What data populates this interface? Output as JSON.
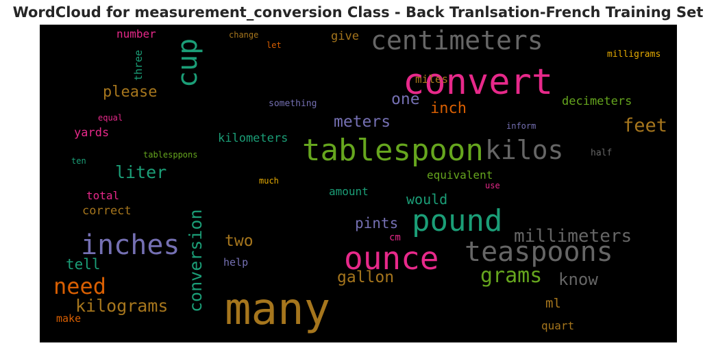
{
  "title": "WordCloud for measurement_conversion Class - Back Tranlsation-French Training Set",
  "words": {
    "many": "many",
    "convert": "convert",
    "tablespoon": "tablespoon",
    "ounce": "ounce",
    "pound": "pound",
    "inches": "inches",
    "teaspoons": "teaspoons",
    "centimeters": "centimeters",
    "kilos": "kilos",
    "cup": "cup",
    "conversion": "conversion",
    "need": "need",
    "grams": "grams",
    "millimeters": "millimeters",
    "kilograms": "kilograms",
    "liter": "liter",
    "feet": "feet",
    "meters": "meters",
    "gallon": "gallon",
    "know": "know",
    "two": "two",
    "one": "one",
    "inch": "inch",
    "please": "please",
    "pints": "pints",
    "tell": "tell",
    "would": "would",
    "decimeters": "decimeters",
    "kilometers": "kilometers",
    "equivalent": "equivalent",
    "ml": "ml",
    "miles": "miles",
    "number": "number",
    "three": "three",
    "yards": "yards",
    "give": "give",
    "correct": "correct",
    "total": "total",
    "amount": "amount",
    "quart": "quart",
    "make": "make",
    "milligrams": "milligrams",
    "something": "something",
    "help": "help",
    "cm": "cm",
    "change": "change",
    "let": "let",
    "equal": "equal",
    "inform": "inform",
    "tablesppons": "tablesppons",
    "ten": "ten",
    "much": "much",
    "use": "use",
    "half": "half"
  }
}
